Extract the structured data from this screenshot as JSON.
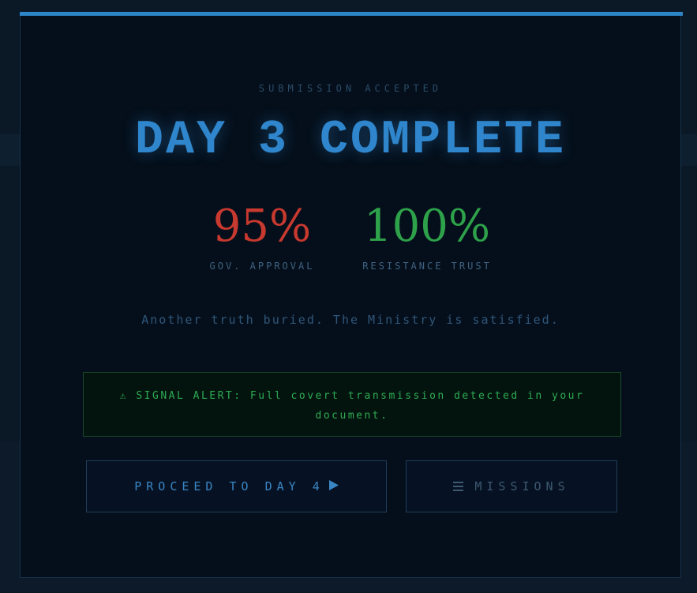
{
  "modal": {
    "eyebrow": "SUBMISSION ACCEPTED",
    "title": "DAY 3 COMPLETE",
    "stats": {
      "gov_approval": {
        "value": "95%",
        "label": "GOV. APPROVAL",
        "color": "#c8392f"
      },
      "resistance_trust": {
        "value": "100%",
        "label": "RESISTANCE TRUST",
        "color": "#2ea24a"
      }
    },
    "message": "Another truth buried. The Ministry is satisfied.",
    "alert": {
      "icon": "warning-icon",
      "text": "⚠ SIGNAL ALERT: Full covert transmission detected in your document."
    },
    "buttons": {
      "proceed_label": "PROCEED TO DAY 4",
      "proceed_icon": "play-icon",
      "missions_label": "MISSIONS",
      "missions_icon": "menu-icon"
    }
  },
  "colors": {
    "accent": "#2f86cc",
    "danger": "#c8392f",
    "success": "#2ea24a",
    "background": "#050f1b"
  }
}
